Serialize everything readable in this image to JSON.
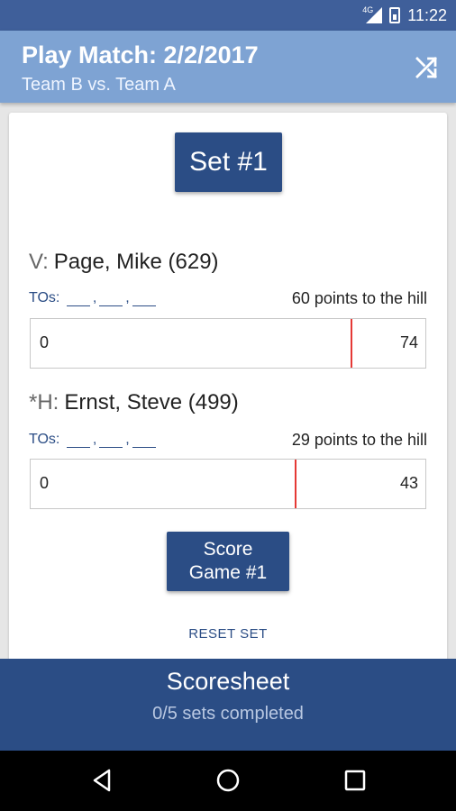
{
  "status": {
    "network": "4G",
    "time": "11:22"
  },
  "appbar": {
    "title": "Play Match: 2/2/2017",
    "subtitle": "Team B vs. Team A",
    "shuffle_icon": "shuffle-icon"
  },
  "set": {
    "label": "Set #1"
  },
  "players": [
    {
      "prefix": "V:",
      "name": "Page, Mike (629)",
      "tos_label": "TOs:",
      "hill_text": "60 points to the hill",
      "score_start": "0",
      "score_end": "74",
      "progress": 0.81
    },
    {
      "prefix": "*H:",
      "name": "Ernst, Steve (499)",
      "tos_label": "TOs:",
      "hill_text": "29 points to the hill",
      "score_start": "0",
      "score_end": "43",
      "progress": 0.67
    }
  ],
  "score_button": {
    "line1": "Score",
    "line2": "Game #1"
  },
  "reset_label": "RESET SET",
  "scoresheet": {
    "title": "Scoresheet",
    "subtitle": "0/5 sets completed"
  },
  "colors": {
    "primary": "#2b4d85",
    "appbar": "#7ea3d3",
    "marker": "#e53935"
  }
}
